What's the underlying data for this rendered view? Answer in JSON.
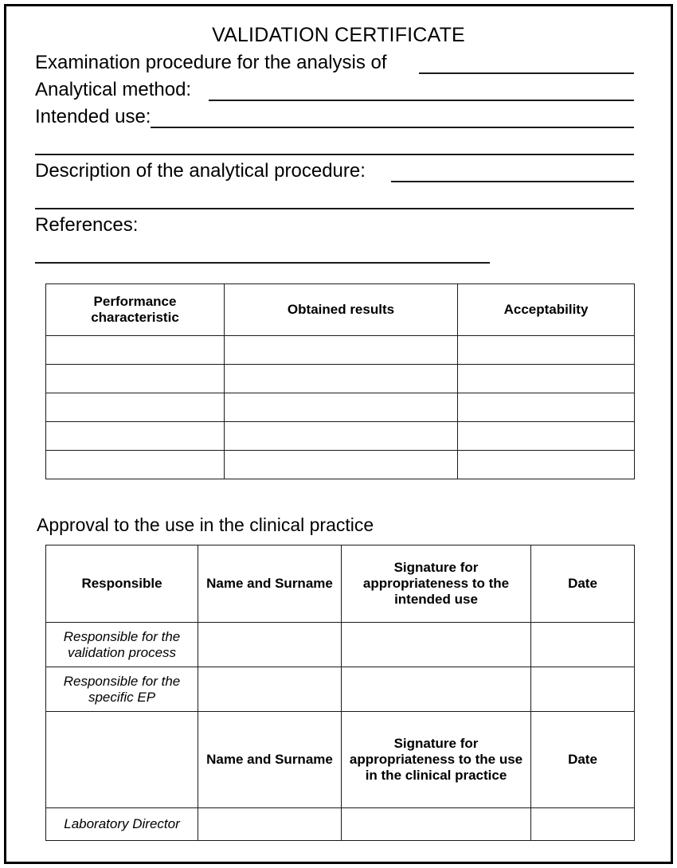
{
  "document": {
    "title": "VALIDATION CERTIFICATE",
    "form_lines": [
      {
        "id": "examination-procedure",
        "label": "Examination procedure for the analysis of",
        "has_rule": true
      },
      {
        "id": "analytical-method",
        "label": "Analytical method:",
        "has_rule": true
      },
      {
        "id": "intended-use",
        "label": "Intended use:",
        "has_rule": true
      },
      {
        "id": "intended-use-cont",
        "label": "",
        "has_rule": true
      },
      {
        "id": "description-procedure",
        "label": "Description of the analytical procedure:",
        "has_rule": true
      },
      {
        "id": "description-cont",
        "label": "",
        "has_rule": true
      },
      {
        "id": "references",
        "label": "References:",
        "has_rule": false
      },
      {
        "id": "references-cont",
        "label": "",
        "has_rule": true
      }
    ],
    "performance_table": {
      "headers": [
        "Performance characteristic",
        "Obtained results",
        "Acceptability"
      ],
      "rows": [
        [
          "",
          "",
          ""
        ],
        [
          "",
          "",
          ""
        ],
        [
          "",
          "",
          ""
        ],
        [
          "",
          "",
          ""
        ],
        [
          "",
          "",
          ""
        ]
      ]
    },
    "approval_heading": "Approval to the use in the clinical practice",
    "approval_table": {
      "headers": [
        "Responsible",
        "Name and Surname",
        "Signature for appropriateness to the intended use",
        "Date"
      ],
      "rows": [
        {
          "role": "Responsible for the validation process",
          "name": "",
          "signature": "",
          "date": ""
        },
        {
          "role": "Responsible for the specific EP",
          "name": "",
          "signature": "",
          "date": ""
        }
      ],
      "second_headers": [
        "",
        "Name and Surname",
        "Signature for appropriateness to the use in the clinical practice",
        "Date"
      ],
      "second_rows": [
        {
          "role": "Laboratory Director",
          "name": "",
          "signature": "",
          "date": ""
        }
      ]
    },
    "colors": {
      "ink": "#000000",
      "rule": "#1a1a1a",
      "page": "#ffffff"
    }
  }
}
